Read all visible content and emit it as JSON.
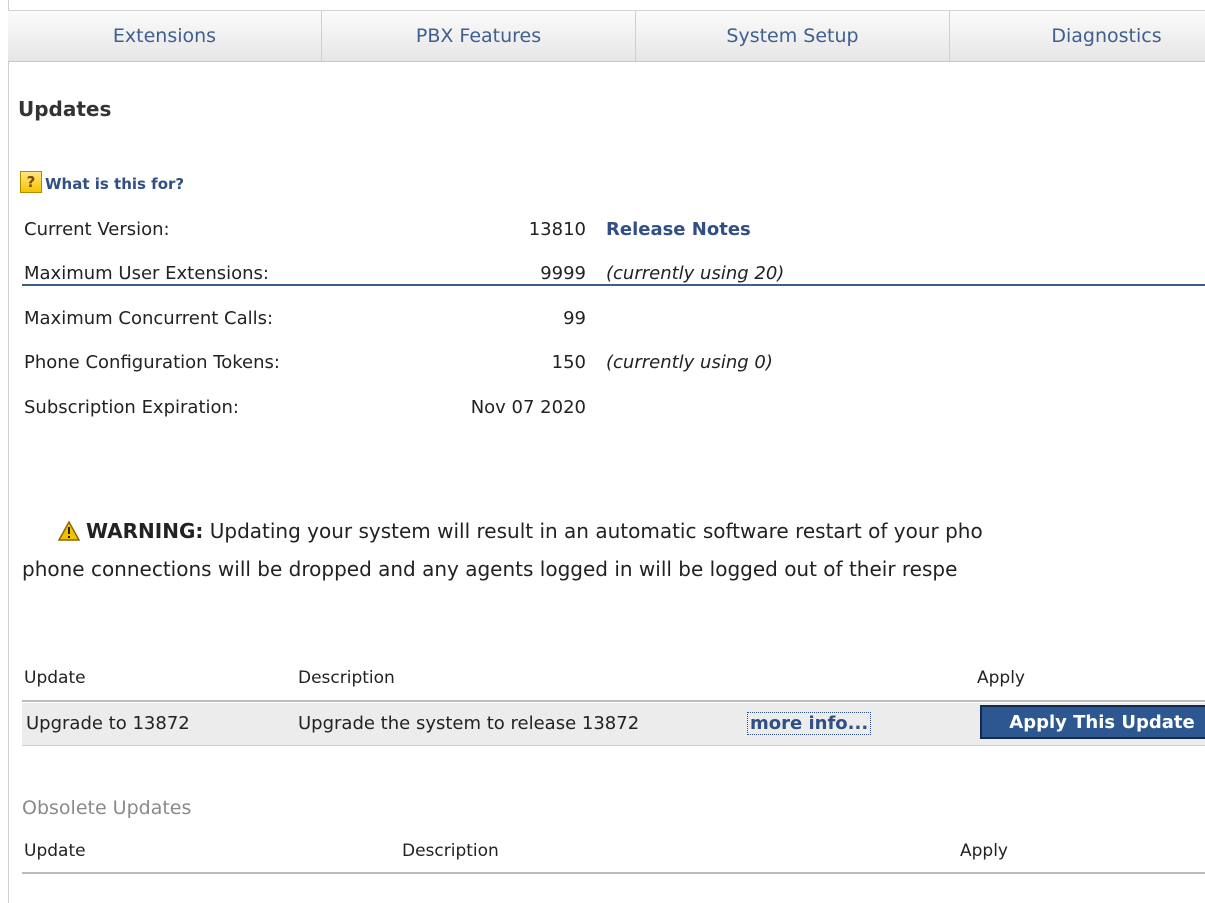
{
  "nav": {
    "tabs": [
      "Extensions",
      "PBX Features",
      "System Setup",
      "Diagnostics"
    ]
  },
  "page": {
    "title": "Updates",
    "help_link": "What is this for?"
  },
  "info": {
    "current_version_label": "Current Version:",
    "current_version_value": "13810",
    "release_notes_link": "Release Notes",
    "max_user_ext_label": "Maximum User Extensions:",
    "max_user_ext_value": "9999",
    "max_user_ext_note": "(currently using 20)",
    "max_calls_label": "Maximum Concurrent Calls:",
    "max_calls_value": "99",
    "tokens_label": "Phone Configuration Tokens:",
    "tokens_value": "150",
    "tokens_note": "(currently using 0)",
    "expiration_label": "Subscription Expiration:",
    "expiration_value": "Nov 07 2020"
  },
  "warning": {
    "label": "WARNING:",
    "line1": "Updating your system will result in an automatic software restart of your pho",
    "line2": "phone connections will be dropped and any agents logged in will be logged out of their respe"
  },
  "updates_table": {
    "headers": [
      "Update",
      "Description",
      "Apply"
    ],
    "rows": [
      {
        "update": "Upgrade to 13872",
        "description": "Upgrade the system to release 13872",
        "more_info": "more info...",
        "apply_button": "Apply This Update"
      }
    ]
  },
  "obsolete": {
    "title": "Obsolete Updates",
    "headers": [
      "Update",
      "Description",
      "Apply"
    ]
  },
  "colors": {
    "link": "#2f4f85",
    "button_bg": "#2d5790",
    "divider": "#3b5d8f",
    "help_icon": "#f5c400",
    "warning_icon": "#f2c200"
  },
  "icons": {
    "help": "question-mark-icon",
    "warning": "warning-triangle-icon"
  }
}
